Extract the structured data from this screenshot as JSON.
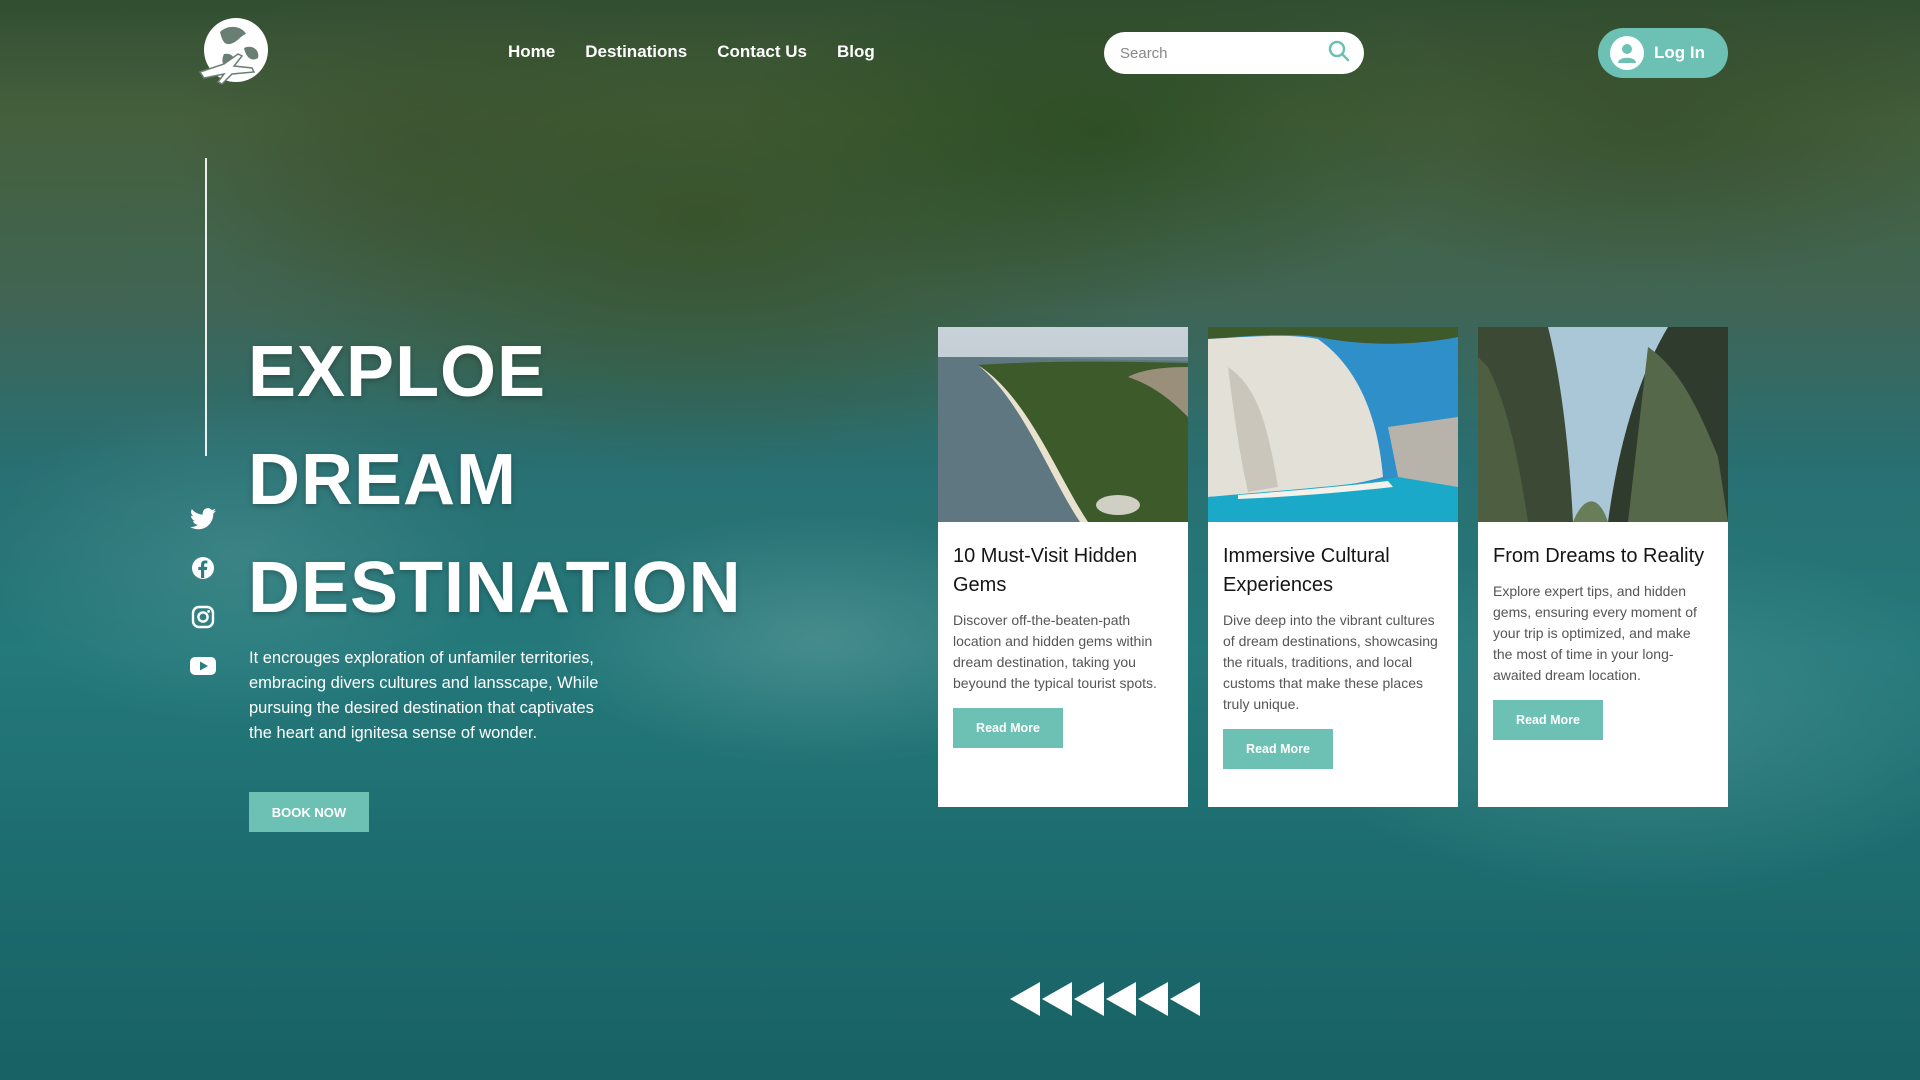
{
  "nav": {
    "items": [
      {
        "label": "Home"
      },
      {
        "label": "Destinations"
      },
      {
        "label": "Contact Us"
      },
      {
        "label": "Blog"
      }
    ]
  },
  "search": {
    "placeholder": "Search",
    "icon": "search-icon"
  },
  "login": {
    "label": "Log In",
    "icon": "user-avatar-icon"
  },
  "social": [
    "twitter-icon",
    "facebook-icon",
    "instagram-icon",
    "youtube-icon"
  ],
  "hero": {
    "title_lines": [
      "EXPLOE",
      "DREAM",
      "DESTINATION"
    ],
    "description": "It encrouges exploration of unfamiler territories, embracing divers cultures and lansscape, While pursuing the desired destination that captivates the heart and ignitesa sense of wonder.",
    "cta": "BOOK NOW"
  },
  "cards": [
    {
      "title": "10 Must-Visit Hidden Gems",
      "text": "Discover off-the-beaten-path location and hidden gems within dream destination, taking you beyound the typical tourist spots.",
      "button": "Read More"
    },
    {
      "title": "Immersive Cultural Experiences",
      "text": "Dive deep into the vibrant cultures of dream destinations, showcasing the rituals, traditions, and local customs that make these places truly unique.",
      "button": "Read More"
    },
    {
      "title": "From Dreams to Reality",
      "text": "Explore expert tips, and hidden gems, ensuring every moment of your trip is optimized, and make the most of time in your long-awaited dream location.",
      "button": "Read More"
    }
  ],
  "pager": {
    "count": 6
  },
  "colors": {
    "accent": "#6cc1b4",
    "card_bg": "#ffffff"
  }
}
